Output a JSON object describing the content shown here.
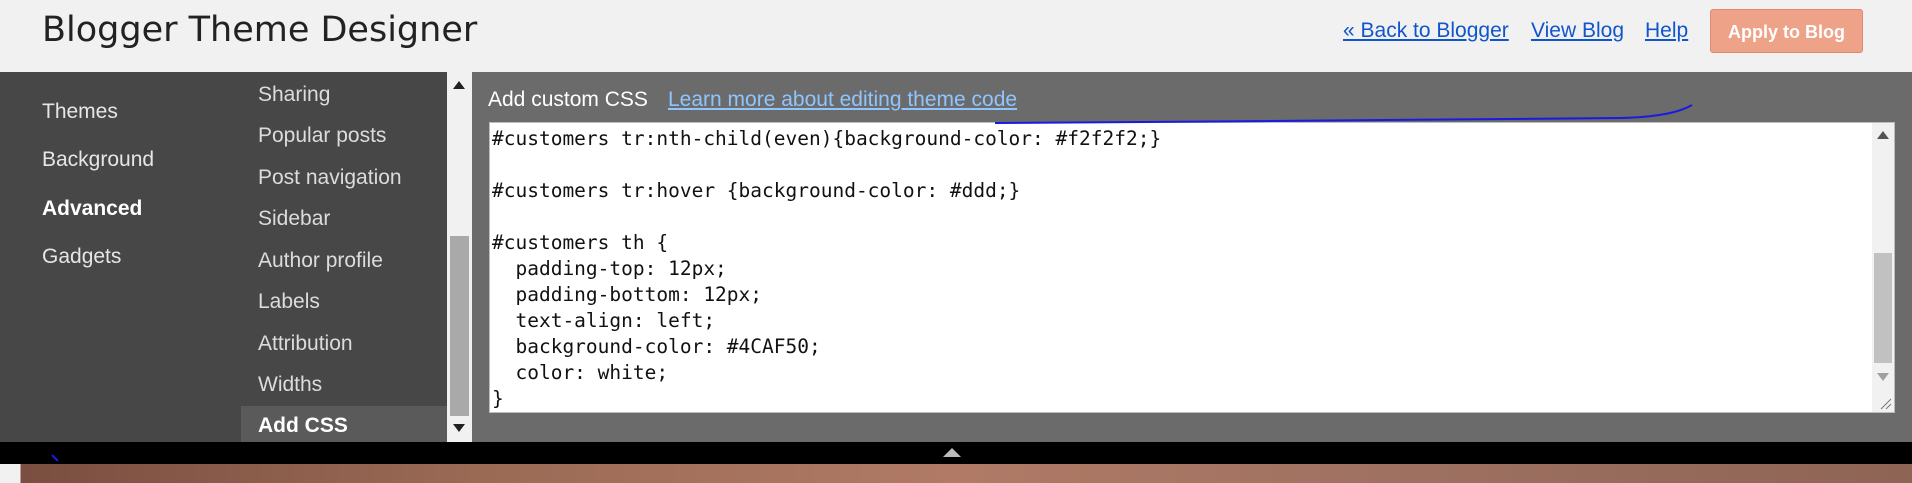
{
  "header": {
    "title": "Blogger Theme Designer",
    "links": [
      "« Back to Blogger",
      "View Blog",
      "Help"
    ],
    "apply_button": "Apply to Blog"
  },
  "left_nav": {
    "items": [
      "Themes",
      "Background",
      "Advanced",
      "Gadgets"
    ],
    "active": "Advanced"
  },
  "sub_nav": {
    "items": [
      "Sharing",
      "Popular posts",
      "Post navigation",
      "Sidebar",
      "Author profile",
      "Labels",
      "Attribution",
      "Widths",
      "Add CSS"
    ],
    "active": "Add CSS"
  },
  "main": {
    "title": "Add custom CSS",
    "link": "Learn more about editing theme code",
    "code_lines": [
      "#customers tr:nth-child(even){background-color: #f2f2f2;}",
      "",
      "#customers tr:hover {background-color: #ddd;}",
      "",
      "#customers th {",
      "  padding-top: 12px;",
      "  padding-bottom: 12px;",
      "  text-align: left;",
      "  background-color: #4CAF50;",
      "  color: white;",
      "}"
    ]
  },
  "colors": {
    "header_bg": "#f1f1f1",
    "nav_bg": "#474747",
    "main_bg": "#6b6b6b",
    "apply_button": "#eea288",
    "link": "#1155cc"
  }
}
